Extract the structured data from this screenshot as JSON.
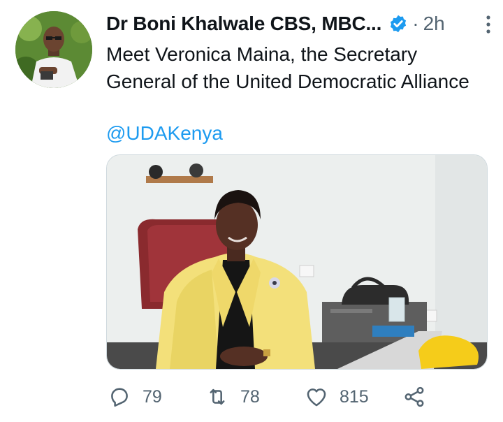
{
  "tweet": {
    "author_name": "Dr Boni Khalwale CBS, MBC...",
    "separator": "·",
    "time": "2h",
    "text": "Meet Veronica Maina, the Secretary General of the United Democratic Alliance",
    "mention": "@UDAKenya"
  },
  "actions": {
    "replies": "79",
    "retweets": "78",
    "likes": "815"
  },
  "icons": {
    "verified": "verified-badge-icon",
    "more": "more-options-icon",
    "reply": "reply-bubble-icon",
    "retweet": "retweet-arrows-icon",
    "like": "heart-icon",
    "share": "share-nodes-icon"
  },
  "colors": {
    "text": "#0f1419",
    "secondary": "#536471",
    "link": "#1d9bf0",
    "verified": "#1d9bf0"
  }
}
